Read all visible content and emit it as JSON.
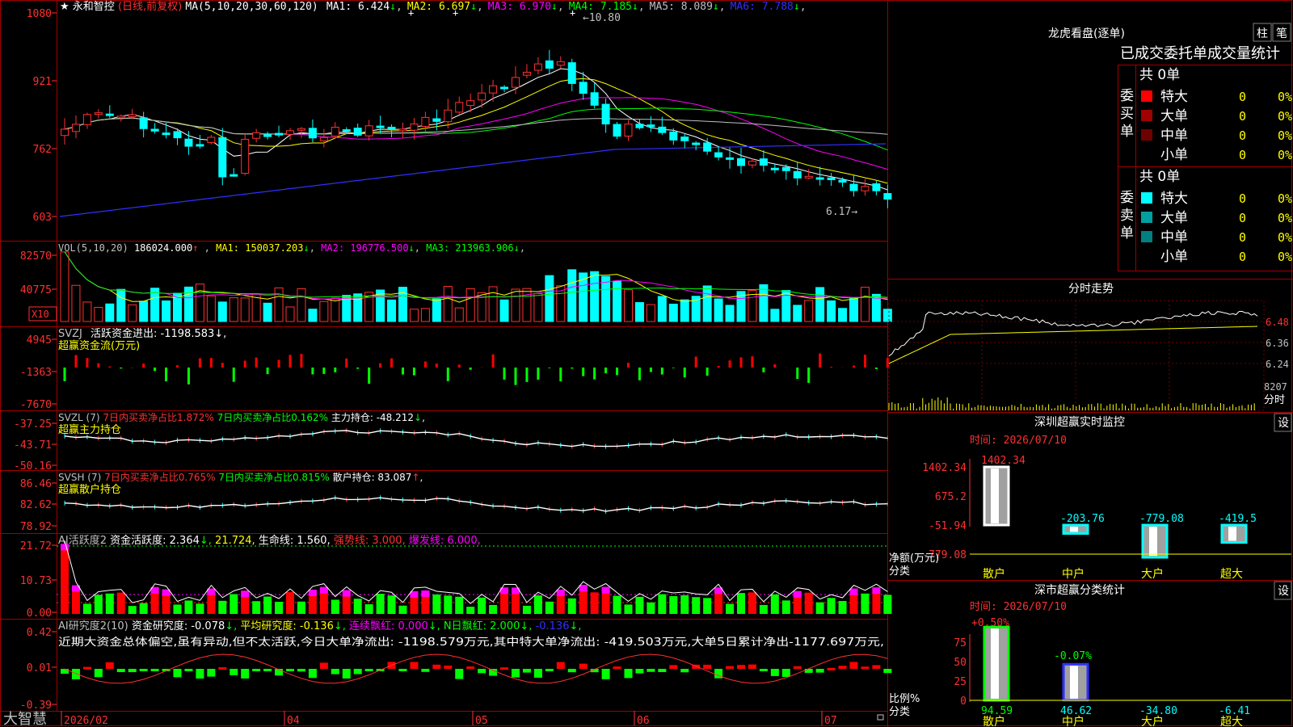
{
  "app": {
    "brand": "大智慧"
  },
  "kline": {
    "header": {
      "star": "★",
      "stock": "永和智控",
      "period": "(日线,前复权)",
      "ma_def": "MA(5,10,20,30,60,120)",
      "items": [
        {
          "label": "MA1: 6.424",
          "color": "#ffffff"
        },
        {
          "label": "MA2: 6.697",
          "color": "#ffff00"
        },
        {
          "label": "MA3: 6.970",
          "color": "#ff00ff"
        },
        {
          "label": "MA4: 7.185",
          "color": "#00ff00"
        },
        {
          "label": "MA5: 8.089",
          "color": "#c0c0c0"
        },
        {
          "label": "MA6: 7.788",
          "color": "#3030ff"
        }
      ]
    },
    "axis_ticks": [
      "1080",
      "921",
      "762",
      "603"
    ],
    "high_marker": "10.80",
    "low_marker": "6.17"
  },
  "volume": {
    "header": {
      "def": "VOL(5,10,20)",
      "value": "186024.000",
      "items": [
        {
          "label": "MA1: 150037.203",
          "color": "#ffff00"
        },
        {
          "label": "MA2: 196776.500",
          "color": "#ff00ff"
        },
        {
          "label": "MA3: 213963.906",
          "color": "#00ff00"
        }
      ]
    },
    "axis_ticks": [
      "82570",
      "40775"
    ],
    "unit_badge": "X10"
  },
  "svzj": {
    "header": {
      "name": "SVZJ",
      "label": "活跃资金进出: -1198.583",
      "sub": "超赢资金流(万元)"
    },
    "axis_ticks": [
      "4945",
      "-1363",
      "-7670"
    ]
  },
  "svzl": {
    "header": {
      "name": "SVZL (7)",
      "a": "7日内买卖净占比1.872%",
      "b": "7日内买卖净占比0.162%",
      "c": "主力持仓: -48.212",
      "sub": "超赢主力持仓"
    },
    "axis_ticks": [
      "-37.25",
      "-43.71",
      "-50.16"
    ]
  },
  "svsh": {
    "header": {
      "name": "SVSH (7)",
      "a": "7日内买卖净占比0.765%",
      "b": "7日内买卖净占比0.815%",
      "c": "散户持仓: 83.087",
      "sub": "超赢散户持仓"
    },
    "axis_ticks": [
      "86.46",
      "82.62",
      "78.92"
    ]
  },
  "ai1": {
    "header": {
      "name": "AI活跃度2",
      "a": "资金活跃度: 2.364",
      "b": "21.724",
      "c": "生命线: 1.560",
      "d": "强势线: 3.000",
      "e": "爆发线: 6.000"
    },
    "axis_ticks": [
      "21.72",
      "10.73",
      "0.00"
    ]
  },
  "ai2": {
    "header": {
      "name": "AI研究度2(10)",
      "a": "资金研究度: -0.078",
      "b": "平均研究度: -0.136",
      "c": "连续飘红: 0.000",
      "d": "N日飘红: 2.000",
      "e": "-0.136"
    },
    "note": "近期大资金总体偏空,虽有异动,但不太活跃,今日大单净流出: -1198.579万元,其中特大单净流出: -419.503万元,大单5日累计净出-1177.697万元,",
    "axis_ticks": [
      "0.42",
      "0.01",
      "-0.39"
    ]
  },
  "timeline": {
    "labels": [
      "2026/02",
      "04",
      "05",
      "06",
      "07"
    ]
  },
  "lhb": {
    "title": "龙虎看盘(逐单)",
    "btn1": "柱",
    "btn2": "笔",
    "heading": "已成交委托单成交量统计",
    "buy": {
      "side_label": "委买单",
      "total": "共 0单",
      "rows": [
        {
          "label": "特大",
          "qty": "0",
          "pct": "0%",
          "color": "#ff0000"
        },
        {
          "label": "大单",
          "qty": "0",
          "pct": "0%",
          "color": "#a00000"
        },
        {
          "label": "中单",
          "qty": "0",
          "pct": "0%",
          "color": "#700000"
        },
        {
          "label": "小单",
          "qty": "0",
          "pct": "0%",
          "color": ""
        }
      ]
    },
    "sell": {
      "side_label": "委卖单",
      "total": "共 0单",
      "rows": [
        {
          "label": "特大",
          "qty": "0",
          "pct": "0%",
          "color": "#00ffff"
        },
        {
          "label": "大单",
          "qty": "0",
          "pct": "0%",
          "color": "#00a0a0"
        },
        {
          "label": "中单",
          "qty": "0",
          "pct": "0%",
          "color": "#008080"
        },
        {
          "label": "小单",
          "qty": "0",
          "pct": "0%",
          "color": ""
        }
      ]
    }
  },
  "intraday": {
    "title": "分时走势",
    "price_ticks": [
      "6.48",
      "6.36",
      "6.24"
    ],
    "vol_tick": "8207",
    "vol_label": "分时"
  },
  "sz_monitor": {
    "title": "深圳超赢实时监控",
    "btn": "设",
    "time": "时间: 2026/07/10",
    "axis_ticks": [
      "1402.34",
      "675.2",
      "-51.94",
      "-779.08"
    ],
    "ylabel": "净额(万元)",
    "xlabel": "分类",
    "chart_data": {
      "type": "bar",
      "categories": [
        "散户",
        "中户",
        "大户",
        "超大"
      ],
      "values": [
        1402.34,
        -203.76,
        -779.08,
        -419.5
      ],
      "value_labels": [
        "1402.34",
        "-203.76",
        "-779.08",
        "-419.5"
      ],
      "ylim": [
        -779.08,
        1402.34
      ]
    }
  },
  "sz_class": {
    "title": "深市超赢分类统计",
    "btn": "设",
    "time": "时间: 2026/07/10",
    "axis_ticks": [
      "75",
      "50",
      "25",
      "0"
    ],
    "ylabel": "比例%",
    "xlabel": "分类",
    "top_labels": [
      "+0.50%",
      "-0.07%"
    ],
    "chart_data": {
      "type": "bar",
      "categories": [
        "散户",
        "中户",
        "大户",
        "超大"
      ],
      "values": [
        94.59,
        46.62,
        -34.8,
        -6.41
      ],
      "value_labels": [
        "94.59",
        "46.62",
        "-34.80",
        "-6.41"
      ],
      "ylim": [
        0,
        100
      ]
    }
  }
}
